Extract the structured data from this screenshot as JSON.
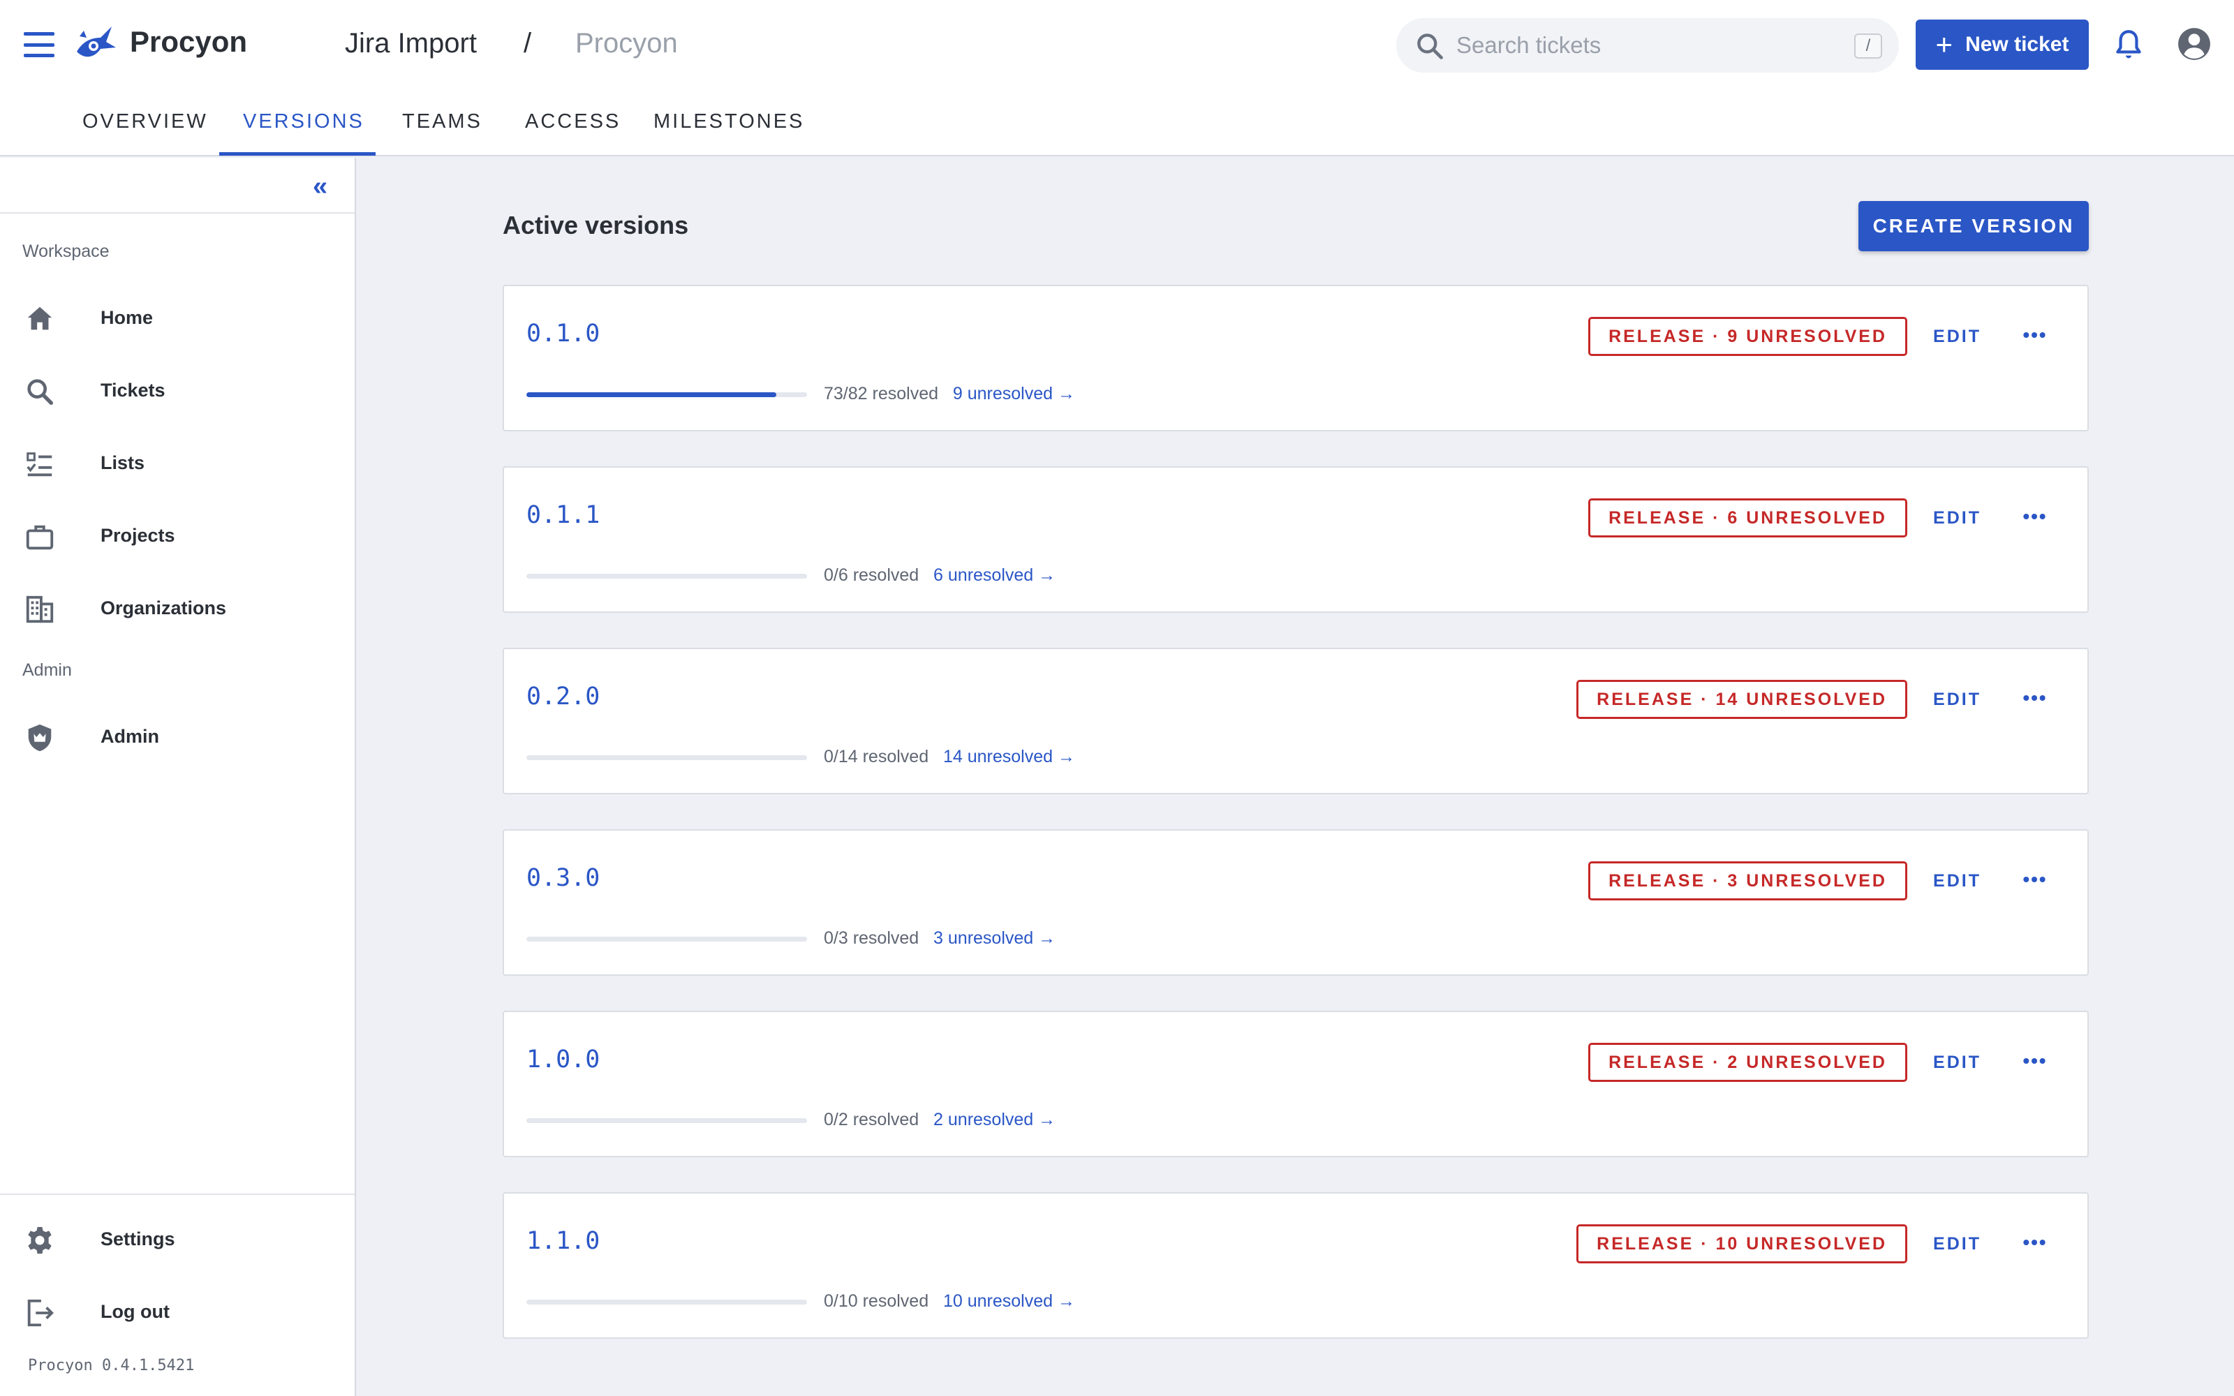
{
  "header": {
    "app_name": "Procyon",
    "breadcrumb": [
      "Jira Import",
      "/",
      "Procyon"
    ],
    "search_placeholder": "Search tickets",
    "search_shortcut": "/",
    "new_ticket_label": "New ticket",
    "icons": [
      "menu-icon",
      "logo",
      "search-icon",
      "plus-icon",
      "bell-icon",
      "account-icon"
    ]
  },
  "tabs": [
    {
      "label": "OVERVIEW",
      "active": false
    },
    {
      "label": "VERSIONS",
      "active": true
    },
    {
      "label": "TEAMS",
      "active": false
    },
    {
      "label": "ACCESS",
      "active": false
    },
    {
      "label": "MILESTONES",
      "active": false
    }
  ],
  "sidebar": {
    "collapse_label": "«",
    "workspace_label": "Workspace",
    "admin_label": "Admin",
    "items": [
      {
        "label": "Home",
        "icon": "home-icon"
      },
      {
        "label": "Tickets",
        "icon": "search-icon"
      },
      {
        "label": "Lists",
        "icon": "checklist-icon"
      },
      {
        "label": "Projects",
        "icon": "briefcase-icon"
      },
      {
        "label": "Organizations",
        "icon": "building-icon"
      },
      {
        "label": "Admin",
        "icon": "shield-crown-icon"
      }
    ],
    "footer_items": [
      {
        "label": "Settings",
        "icon": "gear-icon"
      },
      {
        "label": "Log out",
        "icon": "logout-icon"
      }
    ],
    "version": "Procyon 0.4.1.5421"
  },
  "main": {
    "title": "Active versions",
    "create_label": "CREATE VERSION",
    "edit_label": "EDIT",
    "versions": [
      {
        "name": "0.1.0",
        "badge": "RELEASE · 9 UNRESOLVED",
        "resolved": "73/82 resolved",
        "unresolved": "9 unresolved →",
        "progress": 0.89
      },
      {
        "name": "0.1.1",
        "badge": "RELEASE · 6 UNRESOLVED",
        "resolved": "0/6 resolved",
        "unresolved": "6 unresolved →",
        "progress": 0
      },
      {
        "name": "0.2.0",
        "badge": "RELEASE · 14 UNRESOLVED",
        "resolved": "0/14 resolved",
        "unresolved": "14 unresolved →",
        "progress": 0
      },
      {
        "name": "0.3.0",
        "badge": "RELEASE · 3 UNRESOLVED",
        "resolved": "0/3 resolved",
        "unresolved": "3 unresolved →",
        "progress": 0
      },
      {
        "name": "1.0.0",
        "badge": "RELEASE · 2 UNRESOLVED",
        "resolved": "0/2 resolved",
        "unresolved": "2 unresolved →",
        "progress": 0
      },
      {
        "name": "1.1.0",
        "badge": "RELEASE · 10 UNRESOLVED",
        "resolved": "0/10 resolved",
        "unresolved": "10 unresolved →",
        "progress": 0
      }
    ]
  },
  "colors": {
    "accent": "#2a56c6",
    "danger": "#c62828",
    "background": "#eef0f5"
  }
}
